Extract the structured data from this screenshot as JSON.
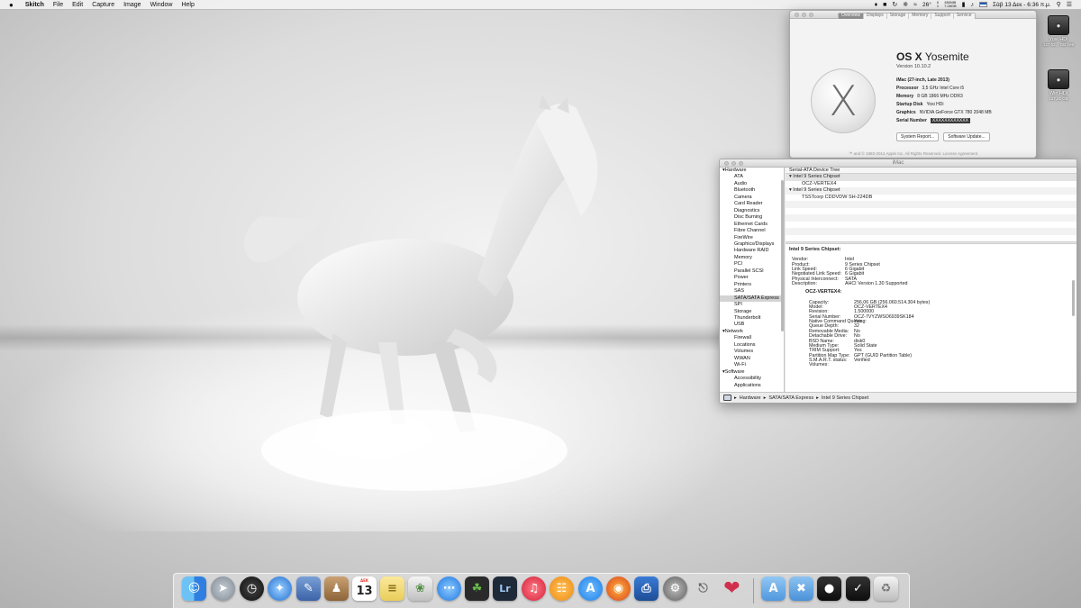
{
  "menubar": {
    "apple_icon": "apple-icon",
    "app_name": "Skitch",
    "menus": [
      "File",
      "Edit",
      "Capture",
      "Image",
      "Window",
      "Help"
    ],
    "status": {
      "temperature": "26°",
      "memory_top": "650MB",
      "memory_bottom": "7.28GB",
      "disk_top": "0",
      "disk_bottom": "1",
      "language": "EL",
      "datetime": "Σάβ 13 Δεκ - 6:36 π.μ."
    }
  },
  "desktop_icons": [
    {
      "name": "Yosi HDi",
      "sub": "127,02... GB free"
    },
    {
      "name": "Win HDi",
      "sub": "127,21 GB"
    }
  ],
  "about": {
    "tabs": [
      "Overview",
      "Displays",
      "Storage",
      "Memory",
      "Support",
      "Service"
    ],
    "active_tab": "Overview",
    "os_name_bold": "OS X",
    "os_name_light": "Yosemite",
    "version": "Version 10.10.2",
    "model": "iMac (27-inch, Late 2013)",
    "specs": [
      {
        "key": "Processor",
        "value": "3,5 GHz Intel Core i5"
      },
      {
        "key": "Memory",
        "value": "8 GB 1866 MHz DDR3"
      },
      {
        "key": "Startup Disk",
        "value": "Yosi HDi"
      },
      {
        "key": "Graphics",
        "value": "NVIDIA GeForce GTX 780 2048 MB"
      }
    ],
    "serial_key": "Serial Number",
    "serial_value": "XXXXXXXXXXXX",
    "buttons": [
      "System Report...",
      "Software Update..."
    ],
    "footer": "™ and © 1983-2014 Apple Inc. All Rights Reserved. License Agreement"
  },
  "sysinfo": {
    "title": "iMac",
    "tree": [
      {
        "label": "Hardware",
        "group": true
      },
      {
        "label": "ATA"
      },
      {
        "label": "Audio"
      },
      {
        "label": "Bluetooth"
      },
      {
        "label": "Camera"
      },
      {
        "label": "Card Reader"
      },
      {
        "label": "Diagnostics"
      },
      {
        "label": "Disc Burning"
      },
      {
        "label": "Ethernet Cards"
      },
      {
        "label": "Fibre Channel"
      },
      {
        "label": "FireWire"
      },
      {
        "label": "Graphics/Displays"
      },
      {
        "label": "Hardware RAID"
      },
      {
        "label": "Memory"
      },
      {
        "label": "PCI"
      },
      {
        "label": "Parallel SCSI"
      },
      {
        "label": "Power"
      },
      {
        "label": "Printers"
      },
      {
        "label": "SAS"
      },
      {
        "label": "SATA/SATA Express",
        "selected": true
      },
      {
        "label": "SPI"
      },
      {
        "label": "Storage"
      },
      {
        "label": "Thunderbolt"
      },
      {
        "label": "USB"
      },
      {
        "label": "Network",
        "group": true
      },
      {
        "label": "Firewall"
      },
      {
        "label": "Locations"
      },
      {
        "label": "Volumes"
      },
      {
        "label": "WWAN"
      },
      {
        "label": "Wi-Fi"
      },
      {
        "label": "Software",
        "group": true
      },
      {
        "label": "Accessibility"
      },
      {
        "label": "Applications"
      }
    ],
    "device_tree_header": "Serial-ATA Device Tree",
    "device_rows": [
      {
        "label": "Intel 9 Series Chipset",
        "level": 0,
        "selected": true
      },
      {
        "label": "OCZ-VERTEX4",
        "level": 1
      },
      {
        "label": "Intel 9 Series Chipset",
        "level": 0
      },
      {
        "label": "TSSTcorp CDDVDW SH-224DB",
        "level": 1
      },
      {
        "label": "",
        "level": 0
      },
      {
        "label": "",
        "level": 0
      },
      {
        "label": "",
        "level": 0
      },
      {
        "label": "",
        "level": 0
      },
      {
        "label": "",
        "level": 0
      }
    ],
    "detail_title": "Intel 9 Series Chipset:",
    "chipset": [
      {
        "key": "Vendor:",
        "value": "Intel"
      },
      {
        "key": "Product:",
        "value": "9 Series Chipset"
      },
      {
        "key": "Link Speed:",
        "value": "6 Gigabit"
      },
      {
        "key": "Negotiated Link Speed:",
        "value": "6 Gigabit"
      },
      {
        "key": "Physical Interconnect:",
        "value": "SATA"
      },
      {
        "key": "Description:",
        "value": "AHCI Version 1.30 Supported"
      }
    ],
    "drive_title": "OCZ-VERTEX4:",
    "drive": [
      {
        "key": "Capacity:",
        "value": "256,06 GB (256.060.514.304 bytes)"
      },
      {
        "key": "Model:",
        "value": "OCZ-VERTEX4"
      },
      {
        "key": "Revision:",
        "value": "1.500000"
      },
      {
        "key": "Serial Number:",
        "value": "OCZ-7VYZWSO6939SK184"
      },
      {
        "key": "Native Command Queuing:",
        "value": "Yes"
      },
      {
        "key": "Queue Depth:",
        "value": "32"
      },
      {
        "key": "Removable Media:",
        "value": "No"
      },
      {
        "key": "Detachable Drive:",
        "value": "No"
      },
      {
        "key": "BSD Name:",
        "value": "disk0"
      },
      {
        "key": "Medium Type:",
        "value": "Solid State"
      },
      {
        "key": "TRIM Support:",
        "value": "Yes"
      },
      {
        "key": "Partition Map Type:",
        "value": "GPT (GUID Partition Table)"
      },
      {
        "key": "S.M.A.R.T. status:",
        "value": "Verified"
      },
      {
        "key": "Volumes:",
        "value": ""
      }
    ],
    "breadcrumb": [
      "Hardware",
      "SATA/SATA Express",
      "Intel 9 Series Chipset"
    ]
  },
  "dock": {
    "calendar_month": "ΔΕΚ",
    "calendar_day": "13",
    "lightroom_label": "Lr",
    "items": [
      {
        "name": "finder-icon",
        "color": "#2f8ee6"
      },
      {
        "name": "launchpad-icon",
        "color": "#9aa3ad"
      },
      {
        "name": "dashboard-icon",
        "color": "#2b2b2b"
      },
      {
        "name": "safari-icon",
        "color": "#1e88e5"
      },
      {
        "name": "preview-icon",
        "color": "#4f7cc0"
      },
      {
        "name": "contacts-icon",
        "color": "#b58a5a"
      },
      {
        "name": "calendar-icon",
        "color": "#ffffff"
      },
      {
        "name": "notes-icon",
        "color": "#f4dd78"
      },
      {
        "name": "photos-icon",
        "color": "#d8d8d8"
      },
      {
        "name": "messages-icon",
        "color": "#2d8fee"
      },
      {
        "name": "evernote-icon",
        "color": "#2a2a2a"
      },
      {
        "name": "lightroom-icon",
        "color": "#2a3341"
      },
      {
        "name": "itunes-icon",
        "color": "#e73a4a"
      },
      {
        "name": "ibooks-icon",
        "color": "#f39a1e"
      },
      {
        "name": "app-store-icon",
        "color": "#1f8ef0"
      },
      {
        "name": "firefox-icon",
        "color": "#e8642a"
      },
      {
        "name": "printer-icon",
        "color": "#2266bb"
      },
      {
        "name": "system-preferences-icon",
        "color": "#8c8c8c"
      },
      {
        "name": "usb-overdrive-icon",
        "color": "#bcbcbc"
      },
      {
        "name": "heart-app-icon",
        "color": "#d0304e"
      },
      {
        "name": "applications-folder-icon",
        "color": "#62a9e8"
      },
      {
        "name": "utilities-folder-icon",
        "color": "#5aa6e8"
      },
      {
        "name": "apple-stack-icon",
        "color": "#1a1a1a"
      },
      {
        "name": "checkmark-stack-icon",
        "color": "#1a1a1a"
      },
      {
        "name": "trash-icon",
        "color": "#dcdcdc"
      }
    ]
  }
}
